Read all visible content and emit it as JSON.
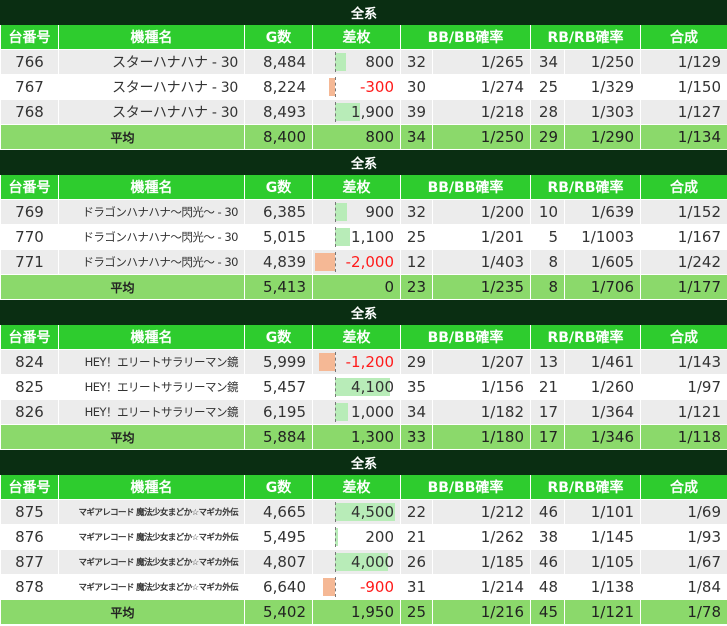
{
  "headers": {
    "no": "台番号",
    "name": "機種名",
    "games": "G数",
    "diff": "差枚",
    "bb": "BB/BB確率",
    "rb": "RB/RB確率",
    "combined": "合成"
  },
  "groups": [
    {
      "title": "全系",
      "name_size": "normal",
      "rows": [
        {
          "no": "766",
          "name": "スターハナハナ - 30",
          "games": "8,484",
          "diff": "800",
          "diff_value": 800,
          "bb": "32",
          "bb_rate": "1/265",
          "rb": "34",
          "rb_rate": "1/250",
          "combined": "1/129"
        },
        {
          "no": "767",
          "name": "スターハナハナ - 30",
          "games": "8,224",
          "diff": "-300",
          "diff_value": -300,
          "bb": "30",
          "bb_rate": "1/274",
          "rb": "25",
          "rb_rate": "1/329",
          "combined": "1/150"
        },
        {
          "no": "768",
          "name": "スターハナハナ - 30",
          "games": "8,493",
          "diff": "1,900",
          "diff_value": 1900,
          "bb": "39",
          "bb_rate": "1/218",
          "rb": "28",
          "rb_rate": "1/303",
          "combined": "1/127"
        }
      ],
      "avg": {
        "label": "平均",
        "games": "8,400",
        "diff": "800",
        "bb": "34",
        "bb_rate": "1/250",
        "rb": "29",
        "rb_rate": "1/290",
        "combined": "1/134"
      }
    },
    {
      "title": "全系",
      "name_size": "sm",
      "rows": [
        {
          "no": "769",
          "name": "ドラゴンハナハナ～閃光～ - 30",
          "games": "6,385",
          "diff": "900",
          "diff_value": 900,
          "bb": "32",
          "bb_rate": "1/200",
          "rb": "10",
          "rb_rate": "1/639",
          "combined": "1/152"
        },
        {
          "no": "770",
          "name": "ドラゴンハナハナ～閃光～ - 30",
          "games": "5,015",
          "diff": "1,100",
          "diff_value": 1100,
          "bb": "25",
          "bb_rate": "1/201",
          "rb": "5",
          "rb_rate": "1/1003",
          "combined": "1/167"
        },
        {
          "no": "771",
          "name": "ドラゴンハナハナ～閃光～ - 30",
          "games": "4,839",
          "diff": "-2,000",
          "diff_value": -2000,
          "bb": "12",
          "bb_rate": "1/403",
          "rb": "8",
          "rb_rate": "1/605",
          "combined": "1/242"
        }
      ],
      "avg": {
        "label": "平均",
        "games": "5,413",
        "diff": "0",
        "bb": "23",
        "bb_rate": "1/235",
        "rb": "8",
        "rb_rate": "1/706",
        "combined": "1/177"
      }
    },
    {
      "title": "全系",
      "name_size": "sm",
      "rows": [
        {
          "no": "824",
          "name": "HEY！エリートサラリーマン鏡",
          "games": "5,999",
          "diff": "-1,200",
          "diff_value": -1200,
          "bb": "29",
          "bb_rate": "1/207",
          "rb": "13",
          "rb_rate": "1/461",
          "combined": "1/143"
        },
        {
          "no": "825",
          "name": "HEY！エリートサラリーマン鏡",
          "games": "5,457",
          "diff": "4,100",
          "diff_value": 4100,
          "bb": "35",
          "bb_rate": "1/156",
          "rb": "21",
          "rb_rate": "1/260",
          "combined": "1/97"
        },
        {
          "no": "826",
          "name": "HEY！エリートサラリーマン鏡",
          "games": "6,195",
          "diff": "1,000",
          "diff_value": 1000,
          "bb": "34",
          "bb_rate": "1/182",
          "rb": "17",
          "rb_rate": "1/364",
          "combined": "1/121"
        }
      ],
      "avg": {
        "label": "平均",
        "games": "5,884",
        "diff": "1,300",
        "bb": "33",
        "bb_rate": "1/180",
        "rb": "17",
        "rb_rate": "1/346",
        "combined": "1/118"
      }
    },
    {
      "title": "全系",
      "name_size": "xs",
      "rows": [
        {
          "no": "875",
          "name": "マギアレコード 魔法少女まどか☆マギカ外伝",
          "games": "4,665",
          "diff": "4,500",
          "diff_value": 4500,
          "bb": "22",
          "bb_rate": "1/212",
          "rb": "46",
          "rb_rate": "1/101",
          "combined": "1/69"
        },
        {
          "no": "876",
          "name": "マギアレコード 魔法少女まどか☆マギカ外伝",
          "games": "5,495",
          "diff": "200",
          "diff_value": 200,
          "bb": "21",
          "bb_rate": "1/262",
          "rb": "38",
          "rb_rate": "1/145",
          "combined": "1/93"
        },
        {
          "no": "877",
          "name": "マギアレコード 魔法少女まどか☆マギカ外伝",
          "games": "4,807",
          "diff": "4,000",
          "diff_value": 4000,
          "bb": "26",
          "bb_rate": "1/185",
          "rb": "46",
          "rb_rate": "1/105",
          "combined": "1/67"
        },
        {
          "no": "878",
          "name": "マギアレコード 魔法少女まどか☆マギカ外伝",
          "games": "6,640",
          "diff": "-900",
          "diff_value": -900,
          "bb": "31",
          "bb_rate": "1/214",
          "rb": "48",
          "rb_rate": "1/138",
          "combined": "1/84"
        }
      ],
      "avg": {
        "label": "平均",
        "games": "5,402",
        "diff": "1,950",
        "bb": "25",
        "bb_rate": "1/216",
        "rb": "45",
        "rb_rate": "1/121",
        "combined": "1/78"
      }
    }
  ],
  "colors": {
    "title_bar": "#0a2e12",
    "header": "#2ecc2e",
    "average_row": "#8bd96b",
    "positive_bar": "#b8ecb8",
    "negative_bar": "#f5b895",
    "negative_text": "#ff1a1a"
  }
}
